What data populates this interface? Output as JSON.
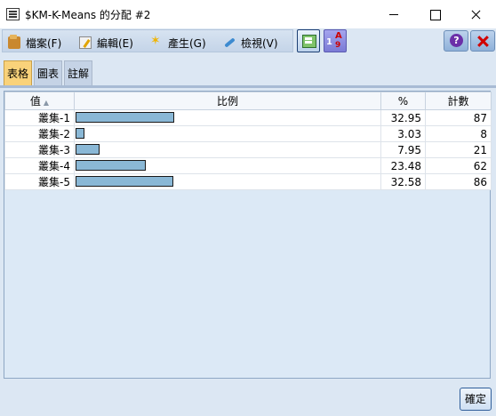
{
  "window": {
    "title": "$KM-K-Means 的分配 #2"
  },
  "menu": {
    "file": "檔案(F)",
    "edit": "編輯(E)",
    "generate": "產生(G)",
    "view": "檢視(V)"
  },
  "tabs": {
    "table": "表格",
    "graph": "圖表",
    "notes": "註解"
  },
  "table": {
    "headers": {
      "value": "值",
      "proportion": "比例",
      "percent": "%",
      "count": "計數"
    },
    "rows": [
      {
        "value": "叢集-1",
        "percent": "32.95",
        "count": "87"
      },
      {
        "value": "叢集-2",
        "percent": "3.03",
        "count": "8"
      },
      {
        "value": "叢集-3",
        "percent": "7.95",
        "count": "21"
      },
      {
        "value": "叢集-4",
        "percent": "23.48",
        "count": "62"
      },
      {
        "value": "叢集-5",
        "percent": "32.58",
        "count": "86"
      }
    ]
  },
  "footer": {
    "ok_label": "確定"
  },
  "colors": {
    "bar_fill": "#8ab8d6",
    "active_tab": "#f9d27a"
  }
}
